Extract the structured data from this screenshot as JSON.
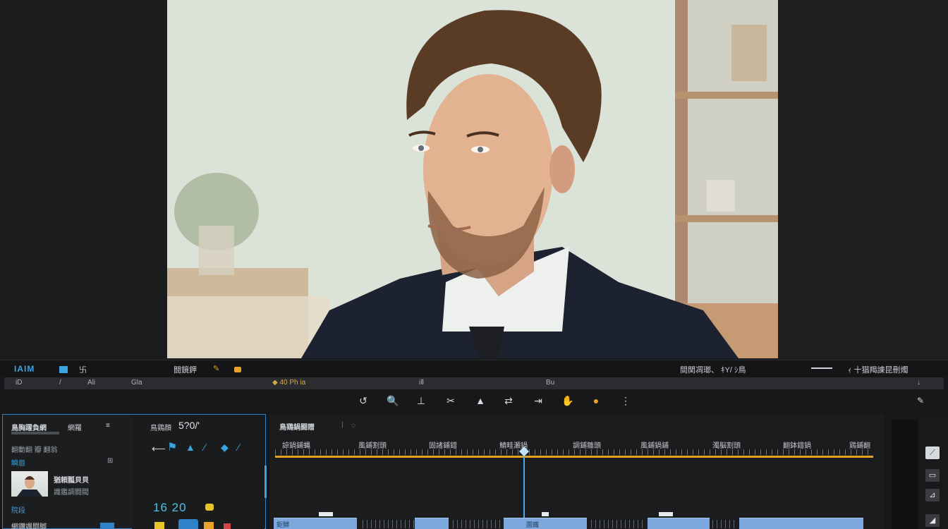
{
  "toolbar": {
    "logo": "IAIM",
    "left_small": "卐",
    "center_label": "闘鏡鉀",
    "right_label": "間関凋瑯、 ｷY/ ｼ鳥",
    "far_right": "ｨ 十猖羯諌昆刪燭"
  },
  "strip": {
    "items": [
      "iD",
      "/",
      "Ali",
      "Gla",
      "◆ 40 Ph ia",
      "iⅡ",
      "Bu"
    ]
  },
  "left_panel": {
    "title": "鳥胸躍負網",
    "tab_label": "網羅",
    "subtitle": "翻動翻 瓣 翻翁",
    "item1": "瞬唇",
    "clip_name": "猶頼瓢貝貝",
    "clip_meta": "識鑑調闘閥",
    "item2": "院段",
    "item3": "網鑽颯闘脚",
    "col2_title": "鳥鶏顔",
    "col2_value": "5?0/'",
    "numbers": "16 20"
  },
  "timeline": {
    "title": "鳥鶏鍋闘贈",
    "ruler_labels": [
      "諒鍋鋪蝿",
      "風鋪割頭",
      "固諸鋪錯",
      "鯖畦瀬鍋",
      "調鋪雛頭",
      "風鋪鍋鋪",
      "濁脳割頭",
      "翻鉢錯鍋",
      "鶏鋪翻"
    ],
    "clips": [
      "鉅嬲",
      "圍鐵"
    ]
  },
  "colors": {
    "accent": "#3aa3e0",
    "work_area": "#e0a41e",
    "clip": "#7da8df"
  }
}
